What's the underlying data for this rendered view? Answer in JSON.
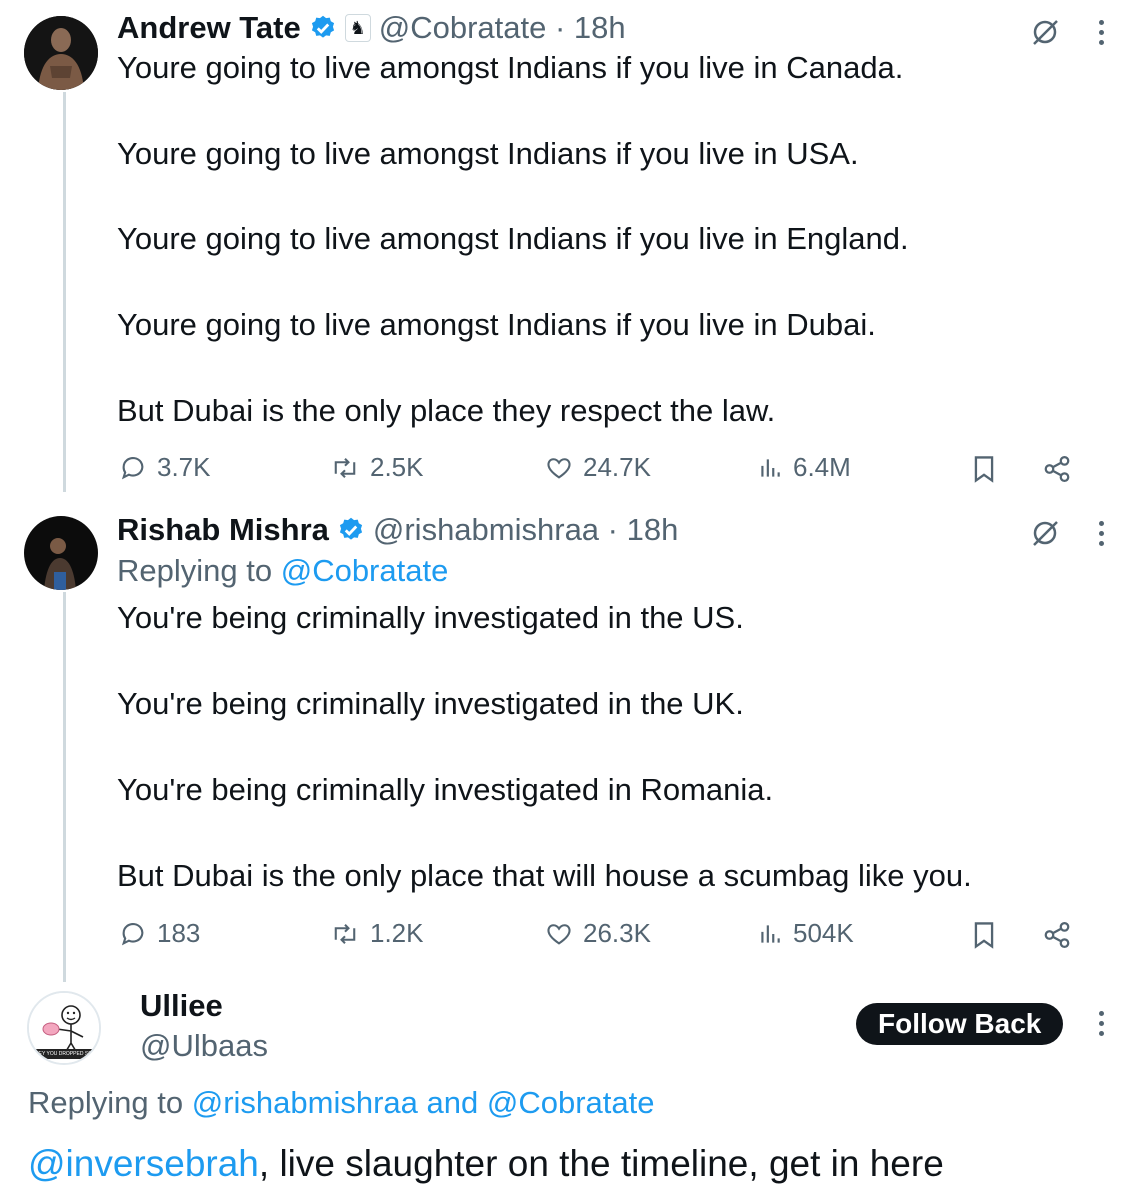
{
  "tweet1": {
    "name": "Andrew Tate",
    "handle_time": "@Cobratate · 18h",
    "lines": [
      "Youre going to live amongst Indians if you live in Canada.",
      "Youre going to live amongst Indians if you live in USA.",
      "Youre going to live amongst Indians if you live in England.",
      "Youre going to live amongst Indians if you live in Dubai.",
      "But Dubai is the only place they respect the law."
    ],
    "stats": {
      "replies": "3.7K",
      "reposts": "2.5K",
      "likes": "24.7K",
      "views": "6.4M"
    }
  },
  "tweet2": {
    "name": "Rishab Mishra",
    "handle_time": "@rishabmishraa · 18h",
    "replying_prefix": "Replying to",
    "replying_handle": "@Cobratate",
    "lines": [
      "You're being criminally investigated in the US.",
      "You're being criminally investigated in the UK.",
      "You're being criminally investigated in Romania.",
      "But Dubai is the only place that will house a scumbag like you."
    ],
    "stats": {
      "replies": "183",
      "reposts": "1.2K",
      "likes": "26.3K",
      "views": "504K"
    }
  },
  "tweet3": {
    "name": "Ulliee",
    "handle": "@Ulbaas",
    "follow_label": "Follow Back",
    "avatar_caption": "HEY YOU DROPPED SOMETHING",
    "replying_prefix": "Replying to",
    "replying_handle_1": "@rishabmishraa",
    "replying_and": "and",
    "replying_handle_2": "@Cobratate",
    "mention": "@inversebrah",
    "text_rest": ", live slaughter on the timeline, get in here"
  },
  "colors": {
    "text": "#0f1419",
    "secondary": "#536471",
    "link": "#1d9bf0",
    "verified": "#1d9bf0",
    "thread_line": "#cfd9de"
  }
}
